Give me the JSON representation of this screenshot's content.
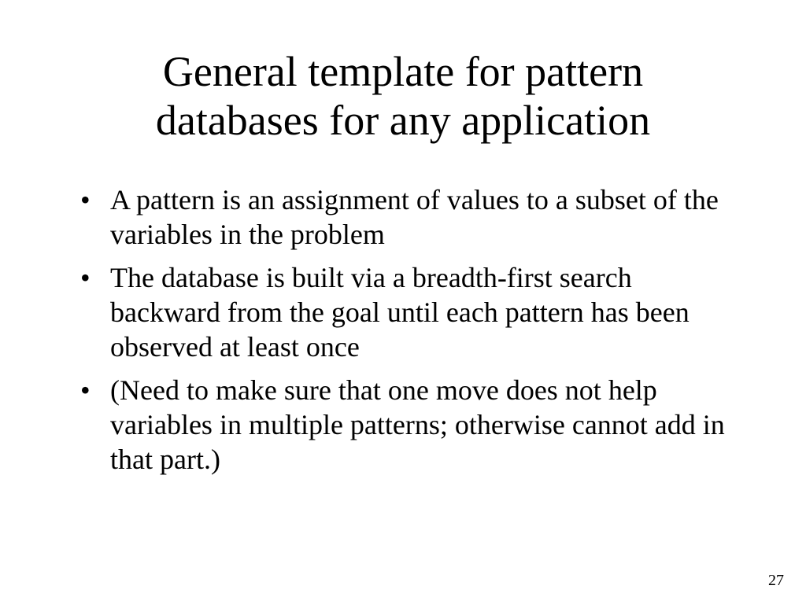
{
  "slide": {
    "title": "General template for pattern databases for any application",
    "bullets": [
      "A pattern is an assignment of values to a subset of the variables in the problem",
      "The database is built via a breadth-first search backward from the goal until each pattern has been observed at least once",
      "(Need to make sure that one move does not help variables in multiple patterns; otherwise cannot add in that part.)"
    ],
    "page_number": "27"
  }
}
